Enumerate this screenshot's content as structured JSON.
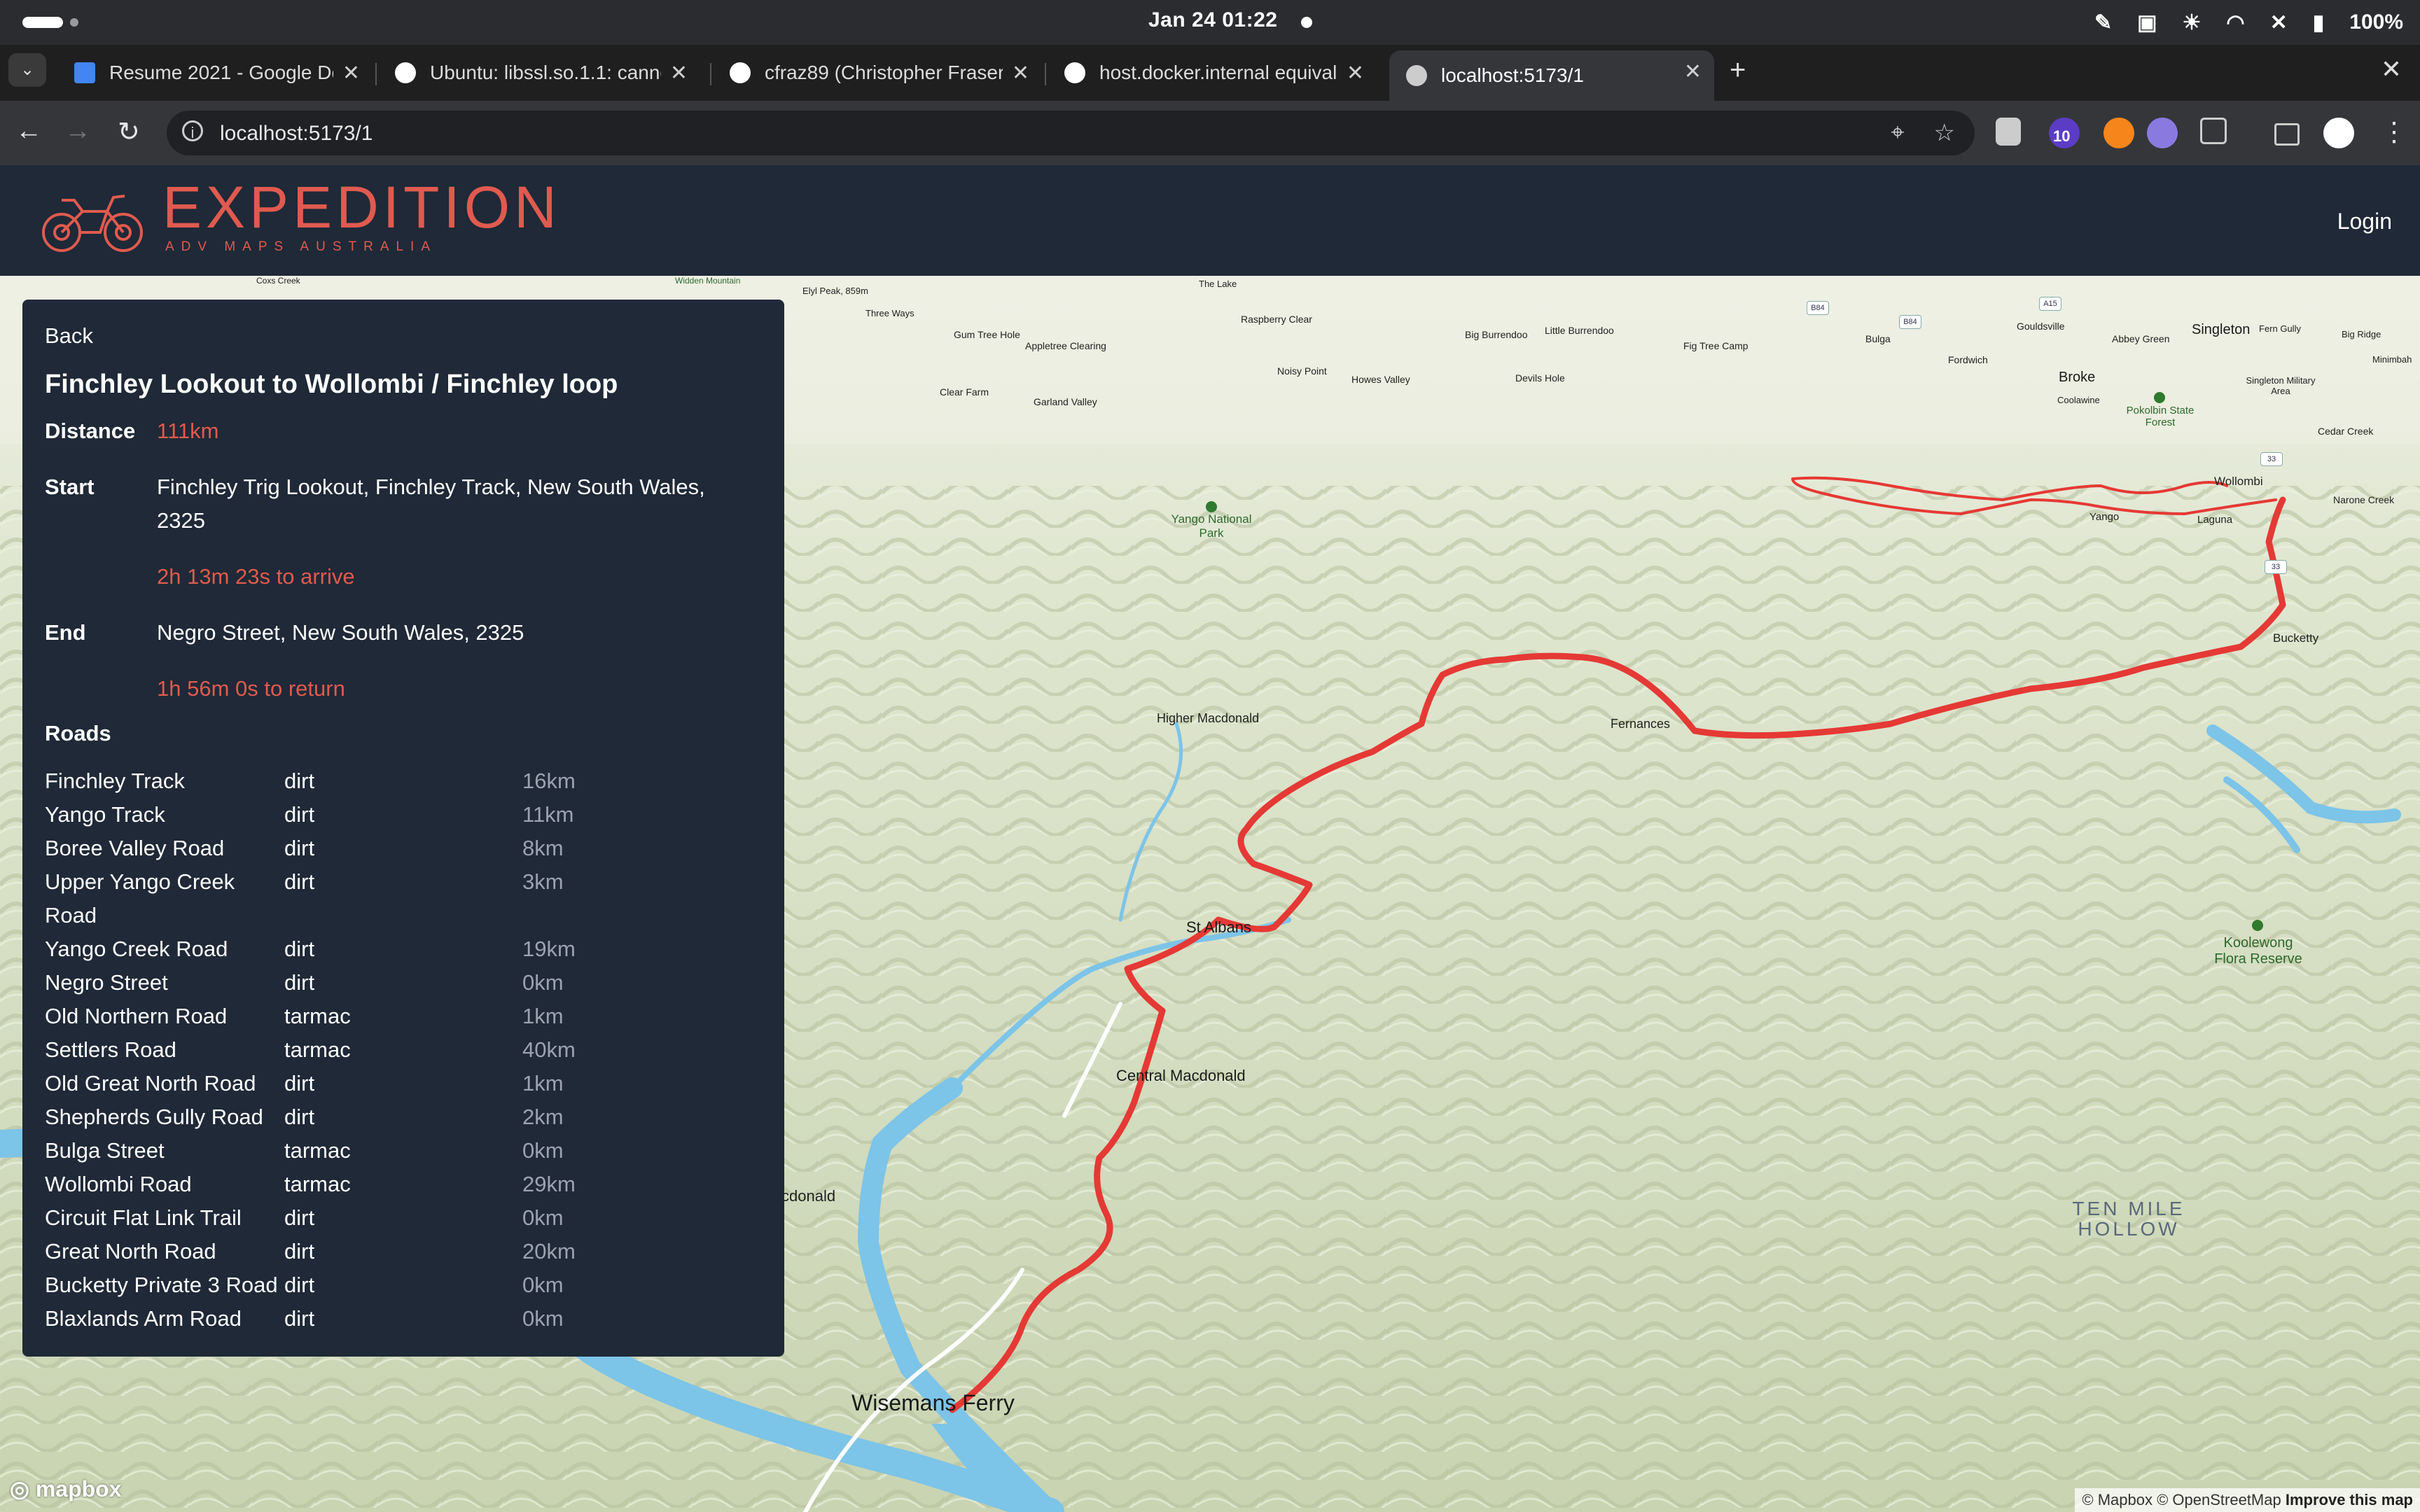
{
  "os": {
    "clock": "Jan 24  01:22",
    "battery": "100%",
    "icons": [
      "eyedropper-icon",
      "clipboard-icon",
      "brightness-icon",
      "wifi-icon",
      "volume-muted-icon",
      "battery-icon"
    ]
  },
  "browser": {
    "tabs": [
      {
        "title": "Resume 2021 - Google Docs",
        "favicon": "google-docs-icon",
        "color": "#4285f4"
      },
      {
        "title": "Ubuntu: libssl.so.1.1: cannot",
        "favicon": "github-icon",
        "color": "#ffffff"
      },
      {
        "title": "cfraz89 (Christopher Fraser)",
        "favicon": "github-icon",
        "color": "#ffffff"
      },
      {
        "title": "host.docker.internal equivalent",
        "favicon": "github-icon",
        "color": "#ffffff"
      },
      {
        "title": "localhost:5173/1",
        "favicon": "globe-icon",
        "color": "#cccccc",
        "active": true
      }
    ],
    "url": "localhost:5173/1",
    "extension_badge": "10"
  },
  "app": {
    "brand": "EXPEDITION",
    "brand_sub": "ADV MAPS AUSTRALIA",
    "login": "Login",
    "accent": "#e05a4f",
    "header_bg": "#1f2937"
  },
  "route": {
    "back": "Back",
    "title": "Finchley Lookout to Wollombi / Finchley loop",
    "distance_label": "Distance",
    "distance": "111km",
    "start_label": "Start",
    "start": "Finchley Trig Lookout, Finchley Track, New South Wales, 2325",
    "arrive": "2h 13m 23s to arrive",
    "end_label": "End",
    "end": "Negro Street, New South Wales, 2325",
    "return": "1h 56m 0s to return",
    "roads_label": "Roads",
    "roads": [
      {
        "name": "Finchley Track",
        "surface": "dirt",
        "distance": "16km"
      },
      {
        "name": "Yango Track",
        "surface": "dirt",
        "distance": "11km"
      },
      {
        "name": "Boree Valley Road",
        "surface": "dirt",
        "distance": "8km"
      },
      {
        "name": "Upper Yango Creek Road",
        "surface": "dirt",
        "distance": "3km"
      },
      {
        "name": "Yango Creek Road",
        "surface": "dirt",
        "distance": "19km"
      },
      {
        "name": "Negro Street",
        "surface": "dirt",
        "distance": "0km"
      },
      {
        "name": "Old Northern Road",
        "surface": "tarmac",
        "distance": "1km"
      },
      {
        "name": "Settlers Road",
        "surface": "tarmac",
        "distance": "40km"
      },
      {
        "name": "Old Great North Road",
        "surface": "dirt",
        "distance": "1km"
      },
      {
        "name": "Shepherds Gully Road",
        "surface": "dirt",
        "distance": "2km"
      },
      {
        "name": "Bulga Street",
        "surface": "tarmac",
        "distance": "0km"
      },
      {
        "name": "Wollombi Road",
        "surface": "tarmac",
        "distance": "29km"
      },
      {
        "name": "Circuit Flat Link Trail",
        "surface": "dirt",
        "distance": "0km"
      },
      {
        "name": "Great North Road",
        "surface": "dirt",
        "distance": "20km"
      },
      {
        "name": "Bucketty Private 3 Road",
        "surface": "dirt",
        "distance": "0km"
      },
      {
        "name": "Blaxlands Arm Road",
        "surface": "dirt",
        "distance": "0km"
      }
    ]
  },
  "map": {
    "labels": {
      "wisemans": "Wisemans Ferry",
      "central": "Central Macdonald",
      "stalbans": "St Albans",
      "higher": "Higher Macdonald",
      "fernances": "Fernances",
      "bucketty": "Bucketty",
      "wollombi": "Wollombi",
      "laguna": "Laguna",
      "yango": "Yango",
      "broke": "Broke",
      "singleton": "Singleton",
      "macdonald_edge": "cdonald",
      "yango_np": "Yango National Park",
      "pokolbin": "Pokolbin State Forest",
      "koolewong": "Koolewong Flora Reserve",
      "tenmile": "TEN MILE HOLLOW",
      "elyl": "Elyl Peak, 859m",
      "threeways": "Three Ways",
      "thelake": "The Lake",
      "raspberry": "Raspberry Clear",
      "gumtree": "Gum Tree Hole",
      "appletree": "Appletree Clearing",
      "clearfarm": "Clear Farm",
      "garland": "Garland Valley",
      "noisy": "Noisy Point",
      "howes": "Howes Valley",
      "devils": "Devils Hole",
      "bigburr": "Big Burrendoo",
      "littleburr": "Little Burrendoo",
      "figtree": "Fig Tree Camp",
      "bulga": "Bulga",
      "fordwich": "Fordwich",
      "gouldsville": "Gouldsville",
      "abbeygreen": "Abbey Green",
      "coolawine": "Coolawine",
      "ferngully": "Fern Gully",
      "bigridge": "Big Ridge",
      "minimbah": "Minimbah",
      "singmil": "Singleton Military Area",
      "cedar": "Cedar Creek",
      "narone": "Narone Creek",
      "widden": "Widden Mountain",
      "coxs": "Coxs Creek"
    },
    "shields": [
      "B84",
      "B84",
      "A15",
      "33",
      "33"
    ],
    "attribution": "© Mapbox © OpenStreetMap",
    "improve": "Improve this map",
    "mapbox": "mapbox",
    "route_color": "#e53935",
    "water_color": "#7cc4e8"
  }
}
